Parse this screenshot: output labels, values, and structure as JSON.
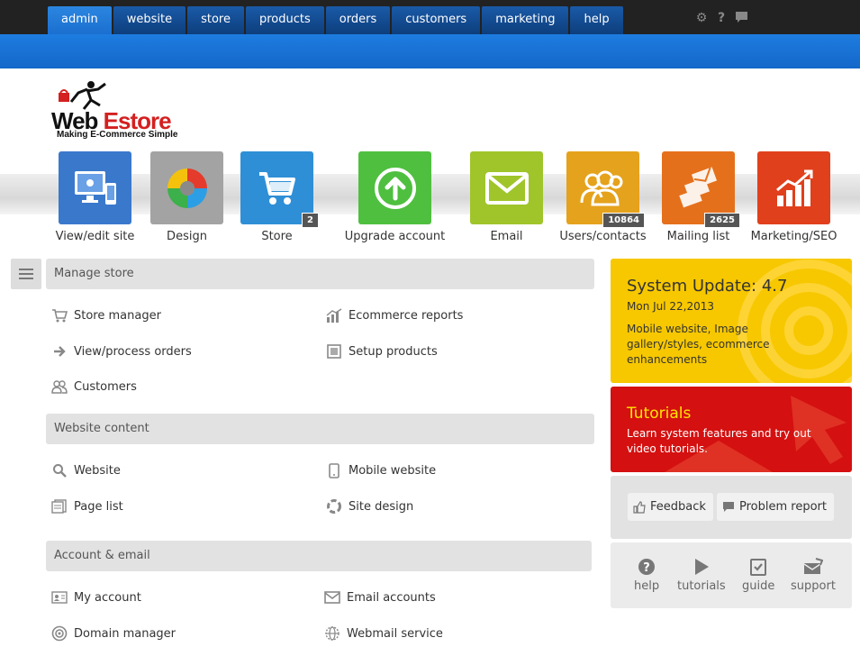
{
  "nav": {
    "tabs": [
      "admin",
      "website",
      "store",
      "products",
      "orders",
      "customers",
      "marketing",
      "help"
    ],
    "active": "admin",
    "icons": [
      "gear-icon",
      "question-icon",
      "chat-icon"
    ]
  },
  "logo": {
    "brand_part1": "Web",
    "brand_part2": "Estore",
    "tagline": "Making E-Commerce Simple"
  },
  "tiles": [
    {
      "label": "View/edit site",
      "color": "#3a78cc",
      "icon": "monitor-device-icon"
    },
    {
      "label": "Design",
      "color": "#a3a3a3",
      "icon": "design-swirl-icon"
    },
    {
      "label": "Store",
      "color": "#2f8fd6",
      "icon": "cart-icon",
      "badge": "2"
    },
    {
      "label": "Upgrade account",
      "color": "#4fbf3f",
      "icon": "upload-arrow-icon"
    },
    {
      "label": "Email",
      "color": "#9fc52b",
      "icon": "envelope-icon"
    },
    {
      "label": "Users/contacts",
      "color": "#e5a21c",
      "icon": "users-icon",
      "badge": "10864"
    },
    {
      "label": "Mailing list",
      "color": "#e5701c",
      "icon": "mailing-icon",
      "badge": "2625"
    },
    {
      "label": "Marketing/SEO",
      "color": "#e0401c",
      "icon": "growth-chart-icon"
    }
  ],
  "sections": [
    {
      "title": "Manage store",
      "items": [
        {
          "label": "Store manager",
          "icon": "cart-icon"
        },
        {
          "label": "Ecommerce reports",
          "icon": "bar-chart-icon"
        },
        {
          "label": "View/process orders",
          "icon": "arrow-right-icon"
        },
        {
          "label": "Setup products",
          "icon": "product-box-icon"
        },
        {
          "label": "Customers",
          "icon": "users-icon"
        }
      ]
    },
    {
      "title": "Website content",
      "items": [
        {
          "label": "Website",
          "icon": "search-icon"
        },
        {
          "label": "Mobile website",
          "icon": "mobile-icon"
        },
        {
          "label": "Page list",
          "icon": "pages-icon"
        },
        {
          "label": "Site design",
          "icon": "design-ring-icon"
        }
      ]
    },
    {
      "title": "Account & email",
      "items": [
        {
          "label": "My account",
          "icon": "id-card-icon"
        },
        {
          "label": "Email accounts",
          "icon": "envelope-icon"
        },
        {
          "label": "Domain manager",
          "icon": "target-icon"
        },
        {
          "label": "Webmail service",
          "icon": "globe-icon"
        }
      ]
    }
  ],
  "update": {
    "title": "System Update: 4.7",
    "date": "Mon Jul 22,2013",
    "desc": "Mobile website, Image gallery/styles, ecommerce enhancements"
  },
  "tutorials": {
    "title": "Tutorials",
    "desc": "Learn system features and try out video tutorials."
  },
  "feedback": {
    "feedback_label": "Feedback",
    "problem_label": "Problem report"
  },
  "help_links": [
    {
      "label": "help",
      "icon": "question-circle-icon"
    },
    {
      "label": "tutorials",
      "icon": "play-icon"
    },
    {
      "label": "guide",
      "icon": "checklist-icon"
    },
    {
      "label": "support",
      "icon": "support-mail-icon"
    }
  ]
}
